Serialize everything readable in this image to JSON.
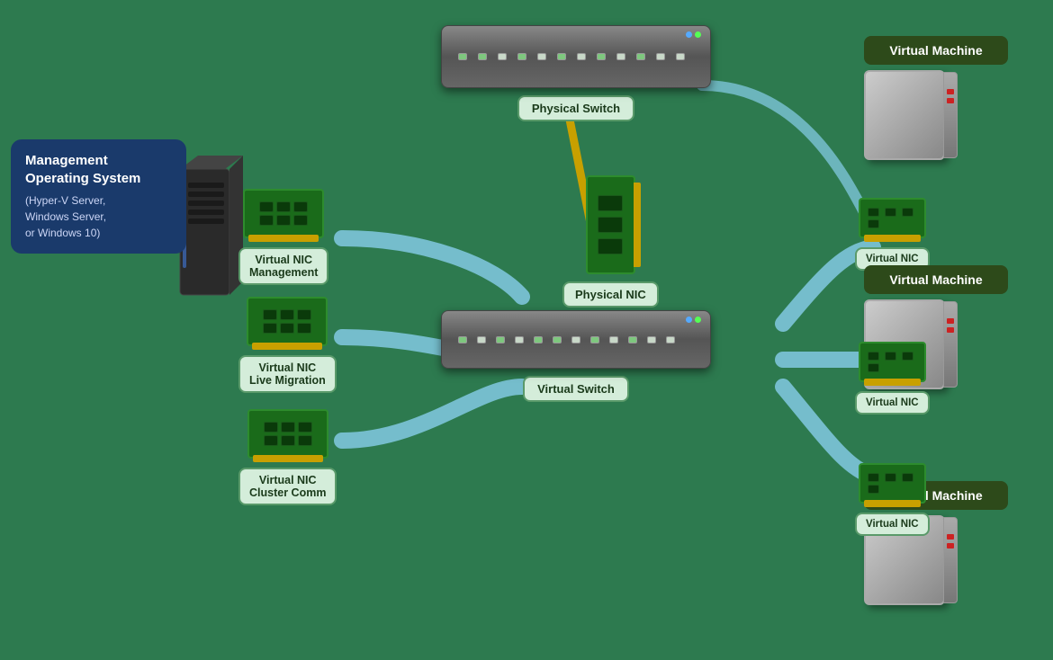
{
  "mgmt_os": {
    "title": "Management Operating System",
    "subtitle": "(Hyper-V Server,\nWindows Server,\nor Windows 10)"
  },
  "physical_switch": {
    "label": "Physical Switch"
  },
  "virtual_switch": {
    "label": "Virtual Switch"
  },
  "physical_nic": {
    "label": "Physical NIC"
  },
  "virtual_nics": [
    {
      "label": "Virtual NIC\nManagement"
    },
    {
      "label": "Virtual NIC\nLive Migration"
    },
    {
      "label": "Virtual NIC\nCluster Comm"
    }
  ],
  "vm_nics": [
    {
      "label": "Virtual NIC"
    },
    {
      "label": "Virtual NIC"
    },
    {
      "label": "Virtual NIC"
    }
  ],
  "virtual_machines": [
    {
      "label": "Virtual Machine"
    },
    {
      "label": "Virtual Machine"
    },
    {
      "label": "Virtual Machine"
    }
  ]
}
